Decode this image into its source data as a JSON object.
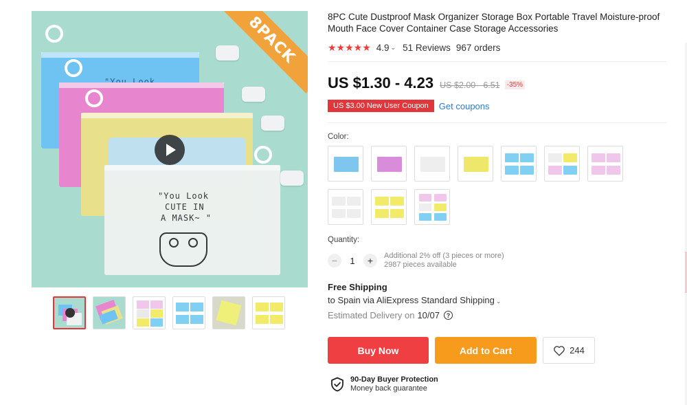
{
  "product": {
    "title": "8PC Cute Dustproof Mask Organizer Storage Box Portable Travel Moisture-proof Mouth Face Cover Container Case Storage Accessories",
    "rating": "4.9",
    "reviews": "51 Reviews",
    "orders": "967 orders",
    "stars_icon": "★★★★★"
  },
  "gallery": {
    "banner": "8PACK",
    "pouch_text_1": "\"You  Look",
    "pouch_text_2": "CUTE   ",
    "white_text_1": "\"You  Look",
    "white_text_2": "CUTE IN",
    "white_text_3": "A MASK~ \"",
    "play_icon": "play-icon",
    "thumbnail_count": 6,
    "active_thumbnail": 0
  },
  "pricing": {
    "price": "US $1.30 - 4.23",
    "original_price": "US $2.00 - 6.51",
    "discount": "-35%",
    "coupon": "US $3.00 New User Coupon",
    "get_coupons": "Get coupons"
  },
  "options": {
    "color_label": "Color:",
    "swatch_count": 10
  },
  "quantity": {
    "label": "Quantity:",
    "value": "1",
    "minus": "−",
    "plus": "+",
    "note_1": "Additional 2% off (3 pieces or more)",
    "note_2": "2987 pieces available"
  },
  "shipping": {
    "title": "Free Shipping",
    "line": "to Spain via AliExpress Standard Shipping",
    "estimated_label": "Estimated Delivery on",
    "estimated_date": "10/07"
  },
  "actions": {
    "buy_now": "Buy Now",
    "add_to_cart": "Add to Cart",
    "wishlist_count": "244"
  },
  "protection": {
    "title": "90-Day Buyer Protection",
    "subtitle": "Money back guarantee"
  },
  "colors": {
    "accent_red": "#ef3f43",
    "cart_orange": "#f79b1c",
    "link_blue": "#2c7bd0",
    "star_red": "#ef3b3b"
  }
}
